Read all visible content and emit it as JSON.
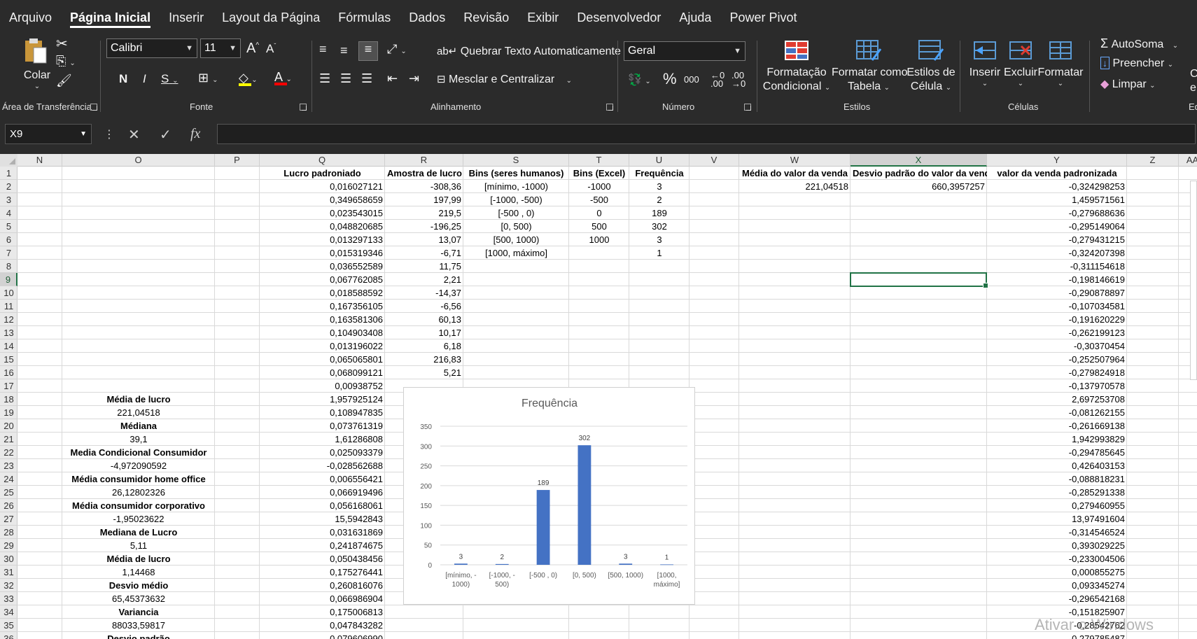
{
  "menu": [
    "Arquivo",
    "Página Inicial",
    "Inserir",
    "Layout da Página",
    "Fórmulas",
    "Dados",
    "Revisão",
    "Exibir",
    "Desenvolvedor",
    "Ajuda",
    "Power Pivot"
  ],
  "clipboard": {
    "paste_label": "Colar",
    "group_label": "Área de Transferência"
  },
  "font": {
    "name": "Calibri",
    "size": "11",
    "bold": "N",
    "italic": "I",
    "underline": "S",
    "color_letter": "A",
    "group_label": "Fonte",
    "highlight_color": "#ffff00",
    "font_color": "#ff0000"
  },
  "alignment": {
    "wrap_label": "Quebrar Texto Automaticamente",
    "merge_label": "Mesclar e Centralizar",
    "group_label": "Alinhamento"
  },
  "number": {
    "format": "Geral",
    "percent": "%",
    "thousands": "000",
    "group_label": "Número"
  },
  "styles": {
    "conditional_l1": "Formatação",
    "conditional_l2": "Condicional",
    "table_l1": "Formatar como",
    "table_l2": "Tabela",
    "cell_l1": "Estilos de",
    "cell_l2": "Célula",
    "group_label": "Estilos"
  },
  "cells_group": {
    "insert": "Inserir",
    "delete": "Excluir",
    "format": "Formatar",
    "group_label": "Células"
  },
  "editing": {
    "autosum": "AutoSoma",
    "fill": "Preencher",
    "clear": "Limpar",
    "cut_l1": "Cl",
    "cut_l2": "e",
    "group_label": "Edi"
  },
  "formula_bar": {
    "name_box": "X9",
    "fx": "fx"
  },
  "columns": [
    "N",
    "O",
    "P",
    "Q",
    "R",
    "S",
    "T",
    "U",
    "V",
    "W",
    "X",
    "Y",
    "Z",
    "AA"
  ],
  "selected_column": "X",
  "rows": [
    "1",
    "2",
    "3",
    "4",
    "5",
    "6",
    "7",
    "8",
    "9",
    "10",
    "11",
    "12",
    "13",
    "14",
    "15",
    "16",
    "17",
    "18",
    "19",
    "20",
    "21",
    "22",
    "23",
    "24",
    "25",
    "26",
    "27",
    "28",
    "29",
    "30",
    "31",
    "32",
    "33",
    "34",
    "35",
    "36"
  ],
  "selected_row": "9",
  "headers": {
    "Q": "Lucro padroniado",
    "R": "Amostra de lucro",
    "S": "Bins (seres humanos)",
    "T": "Bins (Excel)",
    "U": "Frequência",
    "W": "Média do valor da venda",
    "X": "Desvio padrão do valor da venda",
    "Y": "valor da venda padronizada"
  },
  "col_Q": [
    "0,016027121",
    "0,349658659",
    "0,023543015",
    "0,048820685",
    "0,013297133",
    "0,015319346",
    "0,036552589",
    "0,067762085",
    "0,018588592",
    "0,167356105",
    "0,163581306",
    "0,104903408",
    "0,013196022",
    "0,065065801",
    "0,068099121",
    "0,00938752",
    "1,957925124",
    "0,108947835",
    "0,073761319",
    "1,61286808",
    "0,025093379",
    "-0,028562688",
    "0,006556421",
    "0,066919496",
    "0,056168061",
    "15,5942843",
    "0,031631869",
    "0,241874675",
    "0,050438456",
    "0,175276441",
    "0,260816076",
    "0,066986904",
    "0,175006813",
    "0,047843282",
    "0,079606990"
  ],
  "col_R": [
    "-308,36",
    "197,99",
    "219,5",
    "-196,25",
    "13,07",
    "-6,71",
    "11,75",
    "2,21",
    "-14,37",
    "-6,56",
    "60,13",
    "10,17",
    "6,18",
    "216,83",
    "5,21"
  ],
  "col_S": [
    "[mínimo, -1000)",
    "[-1000, -500)",
    "[-500 , 0)",
    "[0, 500)",
    "[500, 1000)",
    "[1000, máximo]"
  ],
  "col_T": [
    "-1000",
    "-500",
    "0",
    "500",
    "1000"
  ],
  "col_U": [
    "3",
    "2",
    "189",
    "302",
    "3",
    "1"
  ],
  "W2": "221,04518",
  "X2": "660,3957257",
  "col_Y": [
    "-0,324298253",
    "1,459571561",
    "-0,279688636",
    "-0,295149064",
    "-0,279431215",
    "-0,324207398",
    "-0,311154618",
    "-0,198146619",
    "-0,290878897",
    "-0,107034581",
    "-0,191620229",
    "-0,262199123",
    "-0,30370454",
    "-0,252507964",
    "-0,279824918",
    "-0,137970578",
    "2,697253708",
    "-0,081262155",
    "-0,261669138",
    "1,942993829",
    "-0,294785645",
    "0,426403153",
    "-0,088818231",
    "-0,285291338",
    "0,279460955",
    "13,97491604",
    "-0,314546524",
    "0,393029225",
    "-0,233004506",
    "0,000855275",
    "0,093345274",
    "-0,296542168",
    "-0,151825907",
    "-0,28542762",
    "-0,279785487"
  ],
  "col_O": [
    {
      "text": "Média de lucro",
      "bold": true
    },
    {
      "text": "221,04518",
      "bold": false
    },
    {
      "text": "Médiana",
      "bold": true
    },
    {
      "text": "39,1",
      "bold": false
    },
    {
      "text": "Media Condicional Consumidor",
      "bold": true
    },
    {
      "text": "-4,972090592",
      "bold": false
    },
    {
      "text": "Média consumidor home office",
      "bold": true
    },
    {
      "text": "26,12802326",
      "bold": false
    },
    {
      "text": "Média consumidor corporativo",
      "bold": true
    },
    {
      "text": "-1,95023622",
      "bold": false
    },
    {
      "text": "Mediana de Lucro",
      "bold": true
    },
    {
      "text": "5,11",
      "bold": false
    },
    {
      "text": "Média de lucro",
      "bold": true
    },
    {
      "text": "1,14468",
      "bold": false
    },
    {
      "text": "Desvio médio",
      "bold": true
    },
    {
      "text": "65,45373632",
      "bold": false
    },
    {
      "text": "Variancia",
      "bold": true
    },
    {
      "text": "88033,59817",
      "bold": false
    },
    {
      "text": "Desvio padrão",
      "bold": true
    }
  ],
  "chart_data": {
    "type": "bar",
    "title": "Frequência",
    "categories": [
      "[mínimo, -1000)",
      "[-1000, -500)",
      "[-500 , 0)",
      "[0, 500)",
      "[500, 1000)",
      "[1000, máximo]"
    ],
    "category_lines": [
      [
        "[mínimo, -",
        "1000)"
      ],
      [
        "[-1000, -",
        "500)"
      ],
      [
        "[-500 , 0)"
      ],
      [
        "[0, 500)"
      ],
      [
        "[500, 1000)"
      ],
      [
        "[1000,",
        "máximo]"
      ]
    ],
    "values": [
      3,
      2,
      189,
      302,
      3,
      1
    ],
    "ylim": [
      0,
      350
    ],
    "yticks": [
      0,
      50,
      100,
      150,
      200,
      250,
      300,
      350
    ],
    "bar_color": "#4472c4",
    "grid": true,
    "data_labels": true,
    "xlabel": "",
    "ylabel": ""
  },
  "watermark": "Ativar o Windows"
}
